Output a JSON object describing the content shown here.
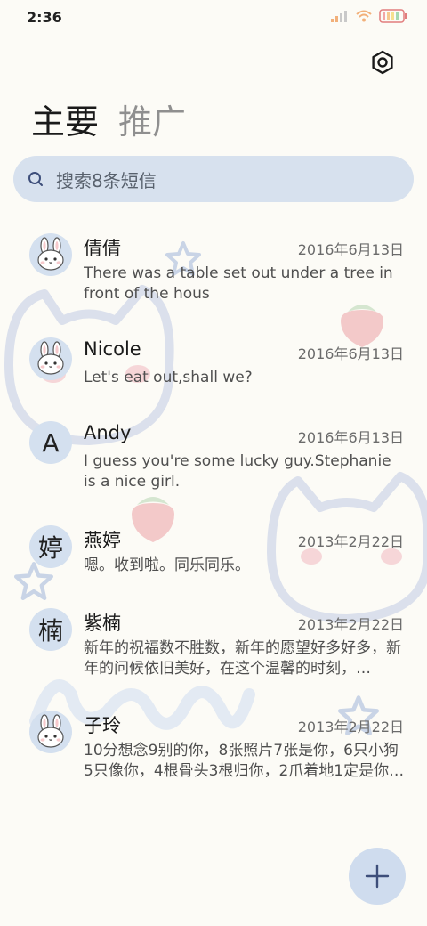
{
  "status_bar": {
    "time": "2:36"
  },
  "tabs": {
    "primary": "主要",
    "promotions": "推广"
  },
  "search": {
    "placeholder": "搜索8条短信"
  },
  "conversations": [
    {
      "avatar_type": "bunny",
      "avatar_text": "",
      "name": "倩倩",
      "date": "2016年6月13日",
      "preview": "There was a table set out under a tree in front of the hous"
    },
    {
      "avatar_type": "bunny",
      "avatar_text": "",
      "name": "Nicole",
      "date": "2016年6月13日",
      "preview": "Let's eat out,shall we?"
    },
    {
      "avatar_type": "letter",
      "avatar_text": "A",
      "name": "Andy",
      "date": "2016年6月13日",
      "preview": "I guess you're some lucky guy.Stephanie is a nice girl."
    },
    {
      "avatar_type": "letter",
      "avatar_text": "婷",
      "name": "燕婷",
      "date": "2013年2月22日",
      "preview": "嗯。收到啦。同乐同乐。"
    },
    {
      "avatar_type": "letter",
      "avatar_text": "楠",
      "name": "紫楠",
      "date": "2013年2月22日",
      "preview": "新年的祝福数不胜数，新年的愿望好多好多，新年的问候依旧美好，在这个温馨的时刻，…"
    },
    {
      "avatar_type": "bunny",
      "avatar_text": "",
      "name": "子玲",
      "date": "2013年2月22日",
      "preview": "10分想念9别的你，8张照片7张是你，6只小狗5只像你，4根骨头3根归你，2爪着地1定是你…"
    }
  ],
  "icons": {
    "settings": "settings-icon",
    "search": "search-icon",
    "compose": "plus-icon",
    "avatar": "bunny-avatar-icon"
  },
  "colors": {
    "background": "#fcfbf6",
    "search_bg": "#d7e1ee",
    "avatar_bg": "#d4e0ef",
    "fab_bg": "#cfdcee",
    "accent": "#3d4e7a"
  }
}
